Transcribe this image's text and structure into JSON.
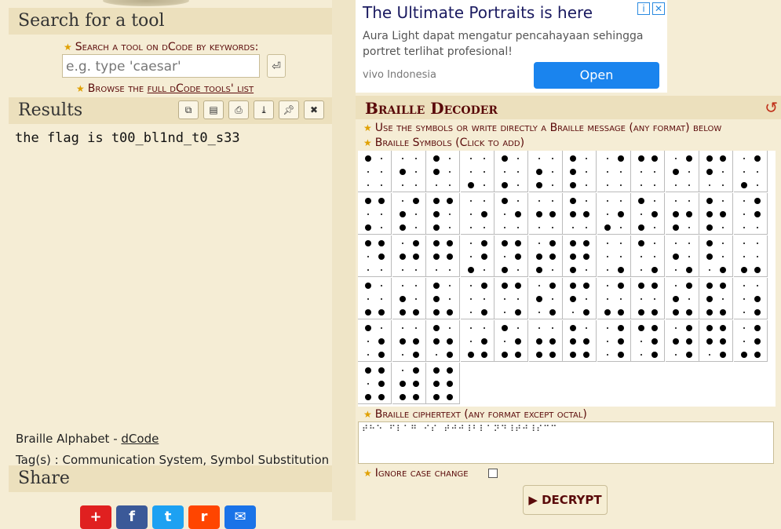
{
  "search": {
    "header": "Search for a tool",
    "label": "Search a tool on dCode by keywords:",
    "placeholder": "e.g. type 'caesar'",
    "go_icon": "enter-icon",
    "browse_prefix": "Browse the ",
    "browse_link": "full dCode tools' list"
  },
  "results": {
    "header": "Results",
    "tools": [
      "copy-icon",
      "save-icon",
      "print-icon",
      "download-icon",
      "pin-icon",
      "close-icon"
    ],
    "output": "the flag is t00_bl1nd_t0_s33",
    "credit_prefix": "Braille Alphabet - ",
    "credit_link": "dCode",
    "tags": "Tag(s) : Communication System, Symbol Substitution"
  },
  "share": {
    "header": "Share",
    "icons": [
      "plus",
      "facebook",
      "twitter",
      "reddit",
      "email"
    ]
  },
  "ad": {
    "title": "The Ultimate Portraits is here",
    "text": "Aura Light dapat mengatur pencahayaan sehingga portret terlihat profesional!",
    "brand": "vivo Indonesia",
    "button": "Open"
  },
  "decoder": {
    "title": "Braille Decoder",
    "info1": "Use the symbols or write directly a Braille message (any format) below",
    "info2": "Braille Symbols (Click to add)",
    "cipher_label": "Braille ciphertext (any format except octal)",
    "cipher_value": "⠞⠓⠑ ⠋⠇⠁⠛ ⠊⠎ ⠞⠚⠚⠸⠃⠇⠁⠝⠙⠸⠞⠚⠸⠎⠉⠉",
    "ignore_label": "Ignore case change",
    "decrypt_button": "DECRYPT",
    "accent": "#5a0a0a"
  }
}
